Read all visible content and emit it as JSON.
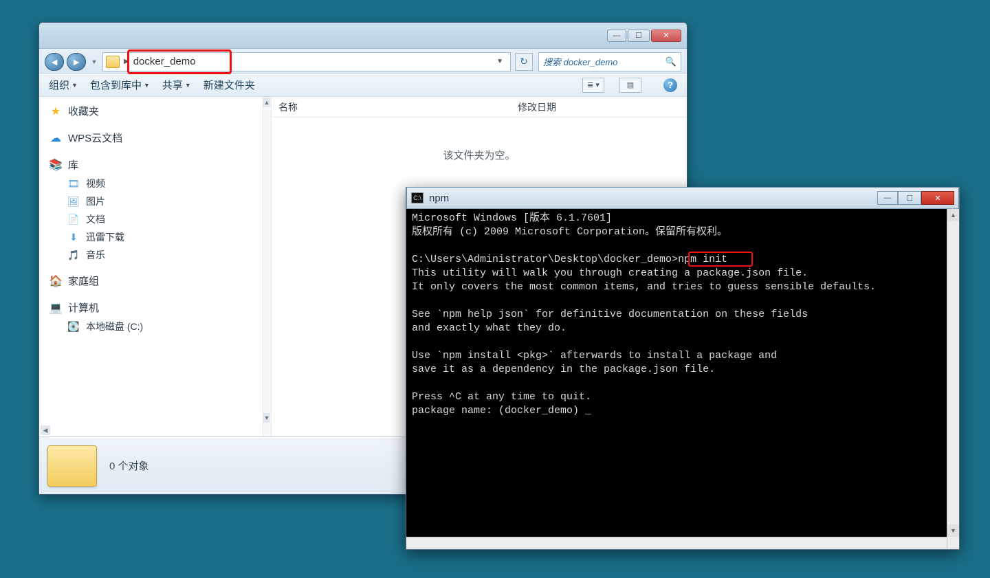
{
  "explorer": {
    "breadcrumb": "docker_demo",
    "search_placeholder": "搜索 docker_demo",
    "toolbar": {
      "organize": "组织",
      "include": "包含到库中",
      "share": "共享",
      "newfolder": "新建文件夹"
    },
    "sidebar": {
      "favorites": "收藏夹",
      "wps": "WPS云文档",
      "library": "库",
      "lib_items": {
        "video": "视频",
        "pictures": "图片",
        "documents": "文档",
        "xunlei": "迅雷下载",
        "music": "音乐"
      },
      "homegroup": "家庭组",
      "computer": "计算机",
      "localdisk": "本地磁盘 (C:)"
    },
    "columns": {
      "name": "名称",
      "modified": "修改日期"
    },
    "empty": "该文件夹为空。",
    "status": "0 个对象"
  },
  "cmd": {
    "title": "npm",
    "prompt_path": "C:\\Users\\Administrator\\Desktop\\docker_demo>",
    "prompt_cmd": "npm init",
    "lines": [
      "Microsoft Windows [版本 6.1.7601]",
      "版权所有 (c) 2009 Microsoft Corporation。保留所有权利。",
      "",
      "C:\\Users\\Administrator\\Desktop\\docker_demo>npm init",
      "This utility will walk you through creating a package.json file.",
      "It only covers the most common items, and tries to guess sensible defaults.",
      "",
      "See `npm help json` for definitive documentation on these fields",
      "and exactly what they do.",
      "",
      "Use `npm install <pkg>` afterwards to install a package and",
      "save it as a dependency in the package.json file.",
      "",
      "Press ^C at any time to quit.",
      "package name: (docker_demo) _"
    ]
  }
}
